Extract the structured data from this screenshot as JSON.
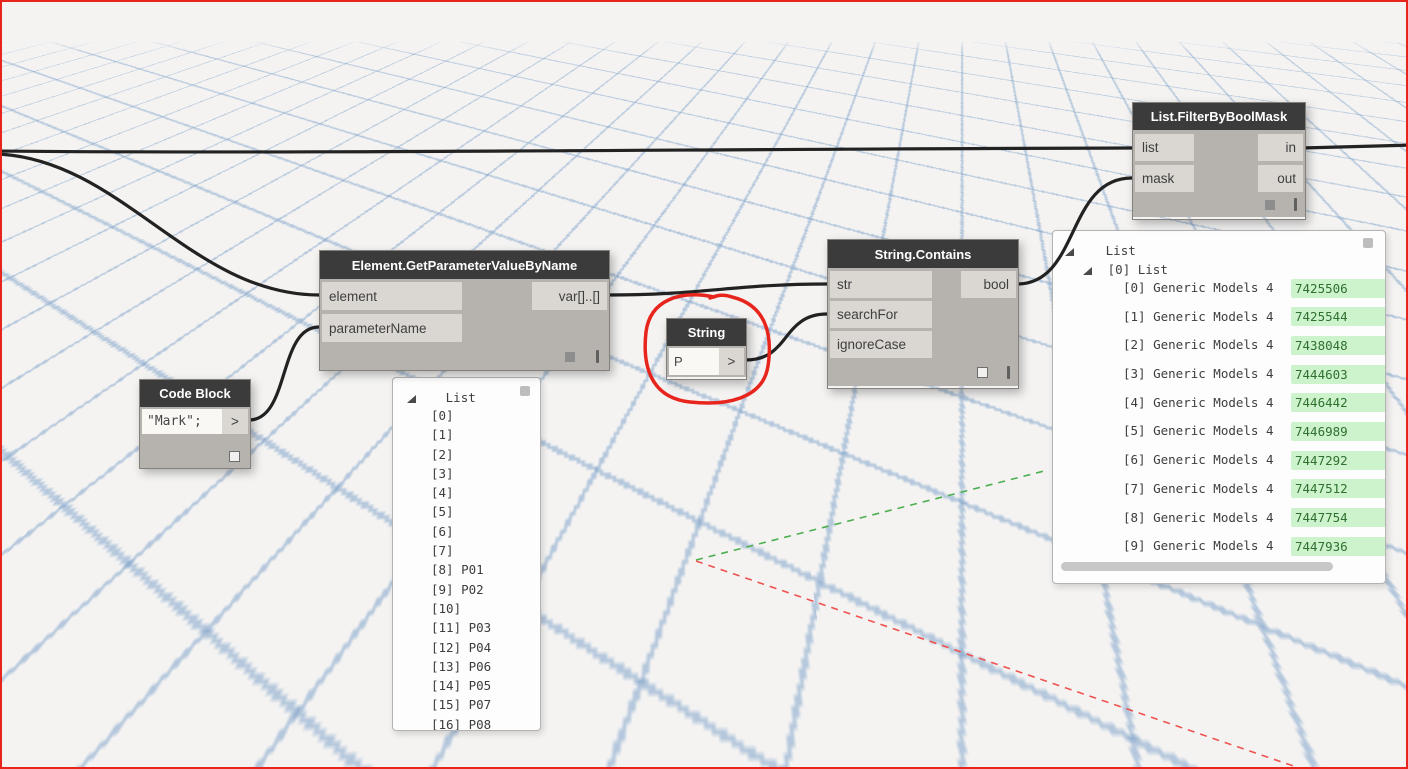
{
  "nodes": {
    "code_block": {
      "title": "Code Block",
      "code": "\"Mark\";",
      "output": ">"
    },
    "get_parameter": {
      "title": "Element.GetParameterValueByName",
      "inputs": [
        "element",
        "parameterName"
      ],
      "outputs": [
        "var[]..[]"
      ]
    },
    "string_input": {
      "title": "String",
      "value": "P",
      "output": ">"
    },
    "string_contains": {
      "title": "String.Contains",
      "inputs": [
        "str",
        "searchFor",
        "ignoreCase"
      ],
      "outputs": [
        "bool"
      ]
    },
    "filter_by_bool_mask": {
      "title": "List.FilterByBoolMask",
      "inputs": [
        "list",
        "mask"
      ],
      "outputs": [
        "in",
        "out"
      ]
    }
  },
  "watch_parameters": {
    "root": "List",
    "items": [
      "[0]",
      "[1]",
      "[2]",
      "[3]",
      "[4]",
      "[5]",
      "[6]",
      "[7]",
      "[8] P01",
      "[9] P02",
      "[10]",
      "[11] P03",
      "[12] P04",
      "[13] P06",
      "[14] P05",
      "[15] P07",
      "[16] P08"
    ]
  },
  "watch_filtered": {
    "root": "List",
    "group": "[0] List",
    "rows": [
      {
        "label": "[0] Generic Models 4",
        "value": "7425506"
      },
      {
        "label": "[1] Generic Models 4",
        "value": "7425544"
      },
      {
        "label": "[2] Generic Models 4",
        "value": "7438048"
      },
      {
        "label": "[3] Generic Models 4",
        "value": "7444603"
      },
      {
        "label": "[4] Generic Models 4",
        "value": "7446442"
      },
      {
        "label": "[5] Generic Models 4",
        "value": "7446989"
      },
      {
        "label": "[6] Generic Models 4",
        "value": "7447292"
      },
      {
        "label": "[7] Generic Models 4",
        "value": "7447512"
      },
      {
        "label": "[8] Generic Models 4",
        "value": "7447754"
      },
      {
        "label": "[9] Generic Models 4",
        "value": "7447936"
      }
    ]
  },
  "colors": {
    "annotation": "#e8251d",
    "badge_bg": "#cdf3cd",
    "badge_text": "#2f6f2f",
    "header_bg": "#3b3b3b"
  }
}
